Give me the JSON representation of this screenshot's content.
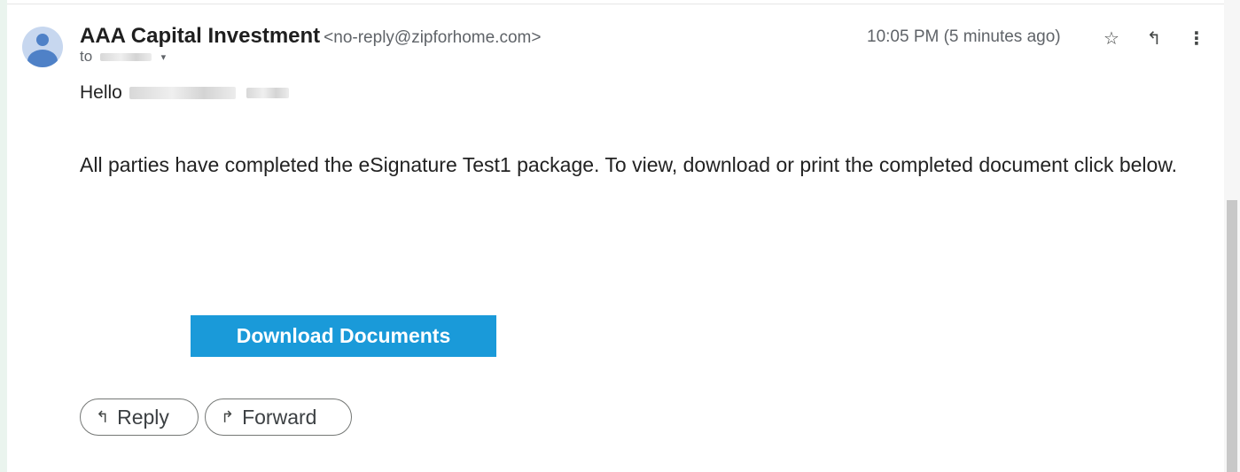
{
  "message": {
    "sender_name": "AAA Capital Investment",
    "sender_email": "<no-reply@zipforhome.com>",
    "to_prefix": "to",
    "timestamp": "10:05 PM (5 minutes ago)"
  },
  "icons": {
    "star": "star-icon",
    "reply": "reply-icon",
    "more": "more-vert-icon",
    "forward": "forward-icon"
  },
  "body": {
    "greeting": "Hello",
    "text": "All parties have completed the eSignature Test1 package. To view, download or print the completed document click below."
  },
  "actions": {
    "download_label": "Download Documents",
    "reply_label": "Reply",
    "forward_label": "Forward"
  },
  "colors": {
    "download_button": "#1a9ad9",
    "avatar": "#4f81c7"
  }
}
